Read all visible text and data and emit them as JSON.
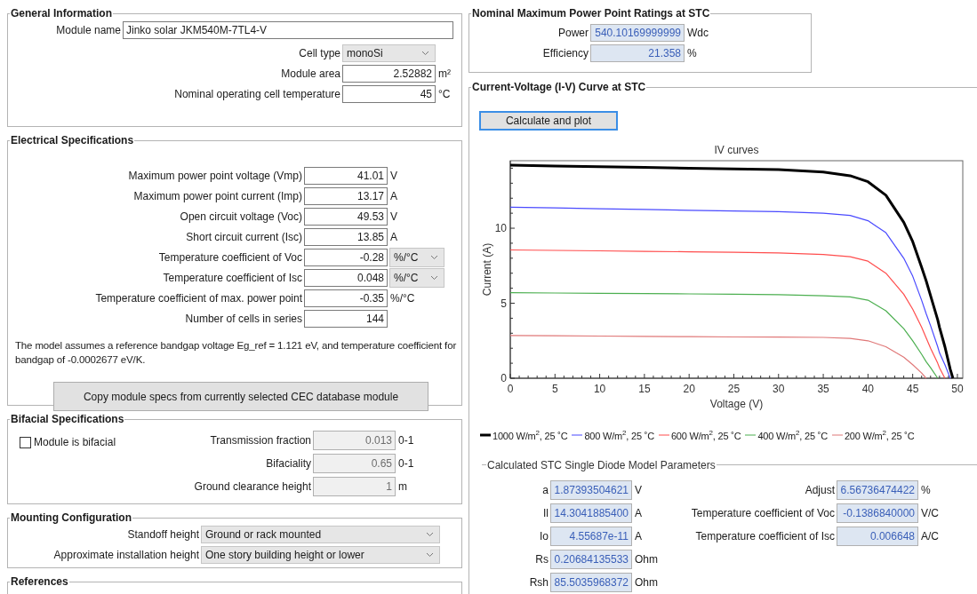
{
  "general": {
    "title": "General Information",
    "module_name": {
      "label": "Module name",
      "value": "Jinko solar JKM540M-7TL4-V"
    },
    "cell_type": {
      "label": "Cell type",
      "value": "monoSi"
    },
    "fields": [
      {
        "label": "Module area",
        "value": "2.52882",
        "unit": "m²"
      },
      {
        "label": "Nominal operating cell temperature",
        "value": "45",
        "unit": "°C"
      }
    ]
  },
  "electrical": {
    "title": "Electrical Specifications",
    "rows": [
      {
        "kind": "text",
        "label": "Maximum power point voltage (Vmp)",
        "value": "41.01",
        "unit": "V"
      },
      {
        "kind": "text",
        "label": "Maximum power point current (Imp)",
        "value": "13.17",
        "unit": "A"
      },
      {
        "kind": "text",
        "label": "Open circuit voltage (Voc)",
        "value": "49.53",
        "unit": "V"
      },
      {
        "kind": "text",
        "label": "Short circuit current (Isc)",
        "value": "13.85",
        "unit": "A"
      },
      {
        "kind": "dropdown",
        "label": "Temperature coefficient of Voc",
        "value": "-0.28",
        "unit": "%/°C"
      },
      {
        "kind": "dropdown",
        "label": "Temperature coefficient of Isc",
        "value": "0.048",
        "unit": "%/°C"
      },
      {
        "kind": "text",
        "label": "Temperature coefficient of max. power point",
        "value": "-0.35",
        "unit": "%/°C"
      },
      {
        "kind": "text",
        "label": "Number of cells in series",
        "value": "144"
      }
    ],
    "note": "The model assumes a reference bandgap voltage Eg_ref = 1.121 eV, and temperature coefficient for bandgap of -0.0002677 eV/K.",
    "copy_button": "Copy module specs from currently selected CEC database module"
  },
  "bifacial": {
    "title": "Bifacial Specifications",
    "checkbox": {
      "label": "Module is bifacial",
      "checked": false
    },
    "fields": [
      {
        "label": "Transmission fraction",
        "value": "0.013",
        "unit": "0-1",
        "disabled": true
      },
      {
        "label": "Bifaciality",
        "value": "0.65",
        "unit": "0-1",
        "disabled": true
      },
      {
        "label": "Ground clearance height",
        "value": "1",
        "unit": "m",
        "disabled": true
      }
    ]
  },
  "mounting": {
    "title": "Mounting Configuration",
    "fields": [
      {
        "label": "Standoff height",
        "value": "Ground or rack mounted"
      },
      {
        "label": "Approximate installation height",
        "value": "One story building height or lower"
      }
    ]
  },
  "references": {
    "title": "References"
  },
  "nominal": {
    "title": "Nominal Maximum Power Point Ratings at STC",
    "fields": [
      {
        "label": "Power",
        "value": "540.10169999999",
        "unit": "Wdc"
      },
      {
        "label": "Efficiency",
        "value": "21.358",
        "unit": "%"
      }
    ]
  },
  "iv_curve": {
    "title": "Current-Voltage (I-V) Curve at STC",
    "button": "Calculate and plot",
    "chart_data": {
      "type": "line",
      "title": "IV curves",
      "xlabel": "Voltage (V)",
      "ylabel": "Current (A)",
      "xlim": [
        0,
        50.6
      ],
      "ylim": [
        0,
        14.5
      ],
      "xticks": [
        0,
        5,
        10,
        15,
        20,
        25,
        30,
        35,
        40,
        45,
        50
      ],
      "yticks": [
        0,
        5,
        10
      ],
      "x": [
        0,
        5,
        10,
        15,
        20,
        25,
        30,
        35,
        38,
        40,
        42,
        44,
        45,
        46,
        46.5,
        47,
        47.8,
        48,
        48.6,
        49,
        49.2,
        49.5
      ],
      "series": [
        {
          "name": "1000 W/m$^{2}$, 25 ˚C",
          "color": "#000000",
          "values": [
            14.2,
            14.15,
            14.1,
            14.05,
            14.0,
            13.95,
            13.9,
            13.75,
            13.5,
            13.1,
            12.2,
            10.4,
            9.1,
            7.4,
            6.5,
            5.5,
            3.9,
            3.4,
            2.1,
            1.1,
            0.6,
            0
          ]
        },
        {
          "name": "800 W/m$^{2}$, 25 ˚C",
          "color": "#4a4aff",
          "values": [
            11.4,
            11.35,
            11.3,
            11.25,
            11.2,
            11.15,
            11.1,
            11.0,
            10.85,
            10.5,
            9.7,
            8.0,
            6.8,
            5.2,
            4.3,
            3.5,
            2.1,
            1.7,
            0.9,
            0.3,
            0,
            null
          ]
        },
        {
          "name": "600 W/m$^{2}$, 25 ˚C",
          "color": "#ff4d4d",
          "values": [
            8.55,
            8.52,
            8.49,
            8.46,
            8.43,
            8.4,
            8.35,
            8.25,
            8.1,
            7.8,
            7.0,
            5.6,
            4.6,
            3.4,
            2.7,
            2.0,
            1.0,
            0.7,
            0,
            null,
            null,
            null
          ]
        },
        {
          "name": "400 W/m$^{2}$, 25 ˚C",
          "color": "#4caf50",
          "values": [
            5.7,
            5.68,
            5.66,
            5.64,
            5.62,
            5.6,
            5.57,
            5.5,
            5.42,
            5.2,
            4.5,
            3.3,
            2.5,
            1.6,
            1.1,
            0.7,
            0,
            null,
            null,
            null,
            null,
            null
          ]
        },
        {
          "name": "200 W/m$^{2}$, 25 ˚C",
          "color": "#e07878",
          "values": [
            2.85,
            2.83,
            2.81,
            2.79,
            2.77,
            2.75,
            2.74,
            2.72,
            2.65,
            2.5,
            2.1,
            1.4,
            0.9,
            0.35,
            0,
            null,
            null,
            null,
            null,
            null,
            null,
            null
          ]
        }
      ]
    }
  },
  "sdm": {
    "title": "Calculated STC Single Diode Model Parameters",
    "left": [
      {
        "label": "a",
        "value": "1.87393504621",
        "unit": "V"
      },
      {
        "label": "Il",
        "value": "14.3041885400",
        "unit": "A"
      },
      {
        "label": "Io",
        "value": "4.55687e-11",
        "unit": "A"
      },
      {
        "label": "Rs",
        "value": "0.20684135533",
        "unit": "Ohm"
      },
      {
        "label": "Rsh",
        "value": "85.5035968372",
        "unit": "Ohm"
      }
    ],
    "right": [
      {
        "label": "Adjust",
        "value": "6.56736474422",
        "unit": "%"
      },
      {
        "label": "Temperature coefficient of Voc",
        "value": "-0.1386840000",
        "unit": "V/C"
      },
      {
        "label": "Temperature coefficient of Isc",
        "value": "0.006648",
        "unit": "A/C"
      }
    ]
  }
}
